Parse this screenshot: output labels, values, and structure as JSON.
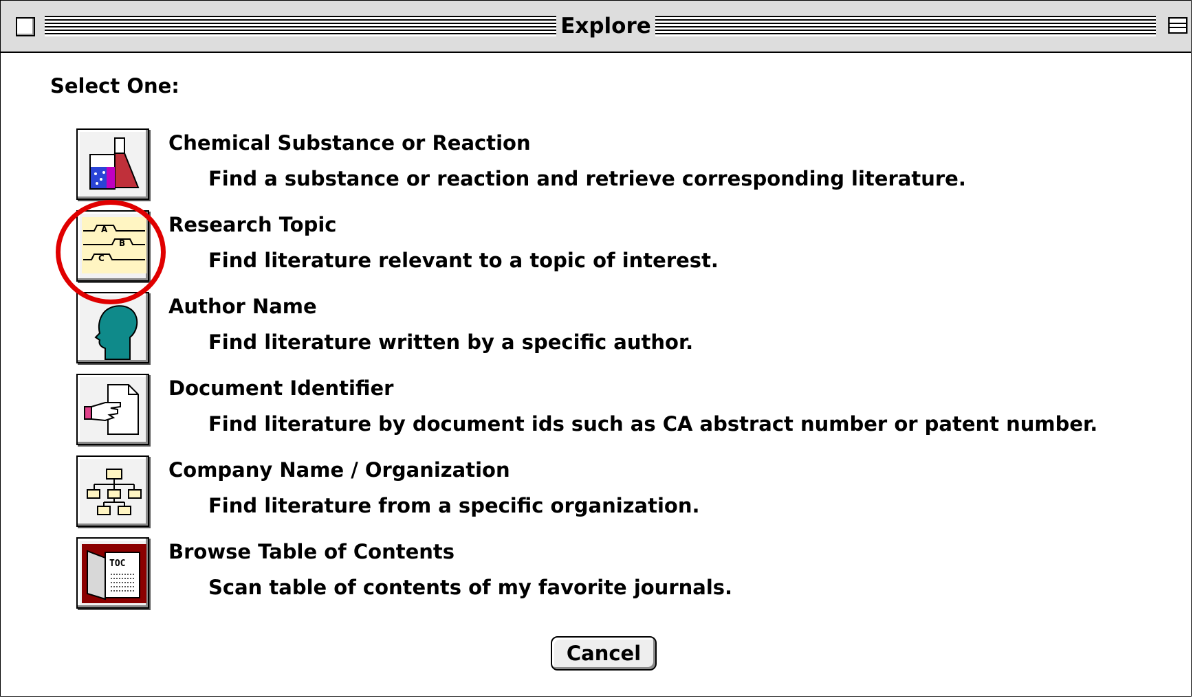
{
  "window": {
    "title": "Explore"
  },
  "prompt": "Select One:",
  "options": [
    {
      "title": "Chemical Substance or Reaction",
      "description": "Find a substance or reaction and retrieve corresponding literature.",
      "icon": "flask-beaker-icon"
    },
    {
      "title": "Research Topic",
      "description": "Find literature relevant to a topic of interest.",
      "icon": "topic-abc-icon"
    },
    {
      "title": "Author Name",
      "description": "Find literature written by a specific author.",
      "icon": "head-profile-icon"
    },
    {
      "title": "Document Identifier",
      "description": "Find literature by document ids such as CA abstract number or patent number.",
      "icon": "hand-document-icon"
    },
    {
      "title": "Company Name / Organization",
      "description": "Find literature from a specific organization.",
      "icon": "org-chart-icon"
    },
    {
      "title": "Browse Table of Contents",
      "description": "Scan table of contents of my favorite journals.",
      "icon": "toc-book-icon"
    }
  ],
  "buttons": {
    "cancel": "Cancel"
  },
  "colors": {
    "highlight": "#e00000",
    "topic_icon_bg": "#fff5c2",
    "author_icon": "#0f8a8a",
    "toc_icon": "#8b0000"
  }
}
